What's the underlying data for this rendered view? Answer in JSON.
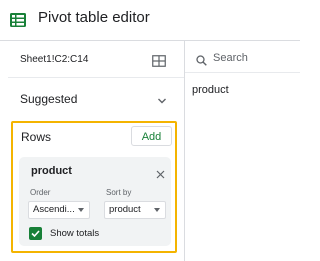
{
  "header": {
    "title": "Pivot table editor",
    "icon": "pivot-table-icon"
  },
  "range": {
    "value": "Sheet1!C2:C14",
    "icon": "grid-icon"
  },
  "suggested": {
    "label": "Suggested",
    "icon": "chevron-down-icon"
  },
  "rows": {
    "label": "Rows",
    "add_label": "Add",
    "field": {
      "name": "product",
      "order_label": "Order",
      "order_value": "Ascendi...",
      "sortby_label": "Sort by",
      "sortby_value": "product",
      "show_totals_label": "Show totals",
      "show_totals_checked": true
    }
  },
  "search": {
    "placeholder": "Search",
    "value": ""
  },
  "field_list": [
    {
      "label": "product"
    }
  ],
  "colors": {
    "accent_green": "#188038",
    "highlight_border": "#f4b400"
  }
}
